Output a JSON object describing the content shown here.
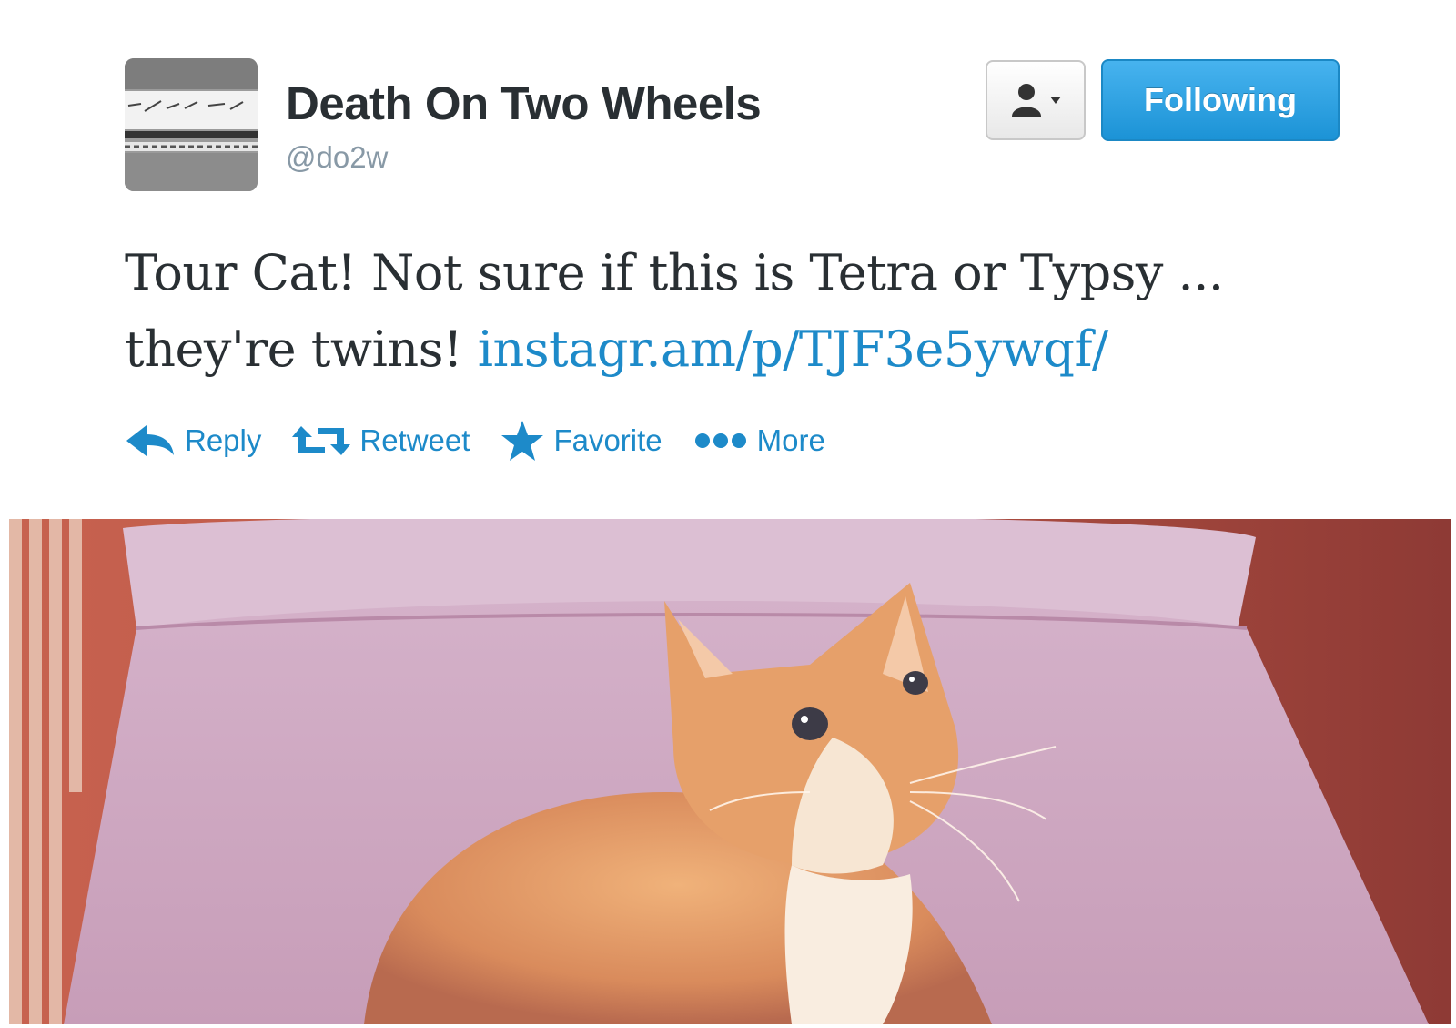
{
  "user": {
    "display_name": "Death On Two Wheels",
    "screen_name": "@do2w"
  },
  "header": {
    "user_menu_icon": "user-dropdown-icon",
    "follow_label": "Following"
  },
  "tweet": {
    "text": "Tour Cat! Not sure if this is Tetra or Typsy ... they're twins! ",
    "link_text": "instagr.am/p/TJF3e5ywqf/"
  },
  "actions": [
    {
      "icon": "reply-icon",
      "label": "Reply"
    },
    {
      "icon": "retweet-icon",
      "label": "Retweet"
    },
    {
      "icon": "star-icon",
      "label": "Favorite"
    },
    {
      "icon": "more-dots-icon",
      "label": "More"
    }
  ],
  "colors": {
    "link": "#1d8ac9",
    "follow_button": "#2a9fe0",
    "text": "#292f33",
    "muted": "#8899a6"
  }
}
